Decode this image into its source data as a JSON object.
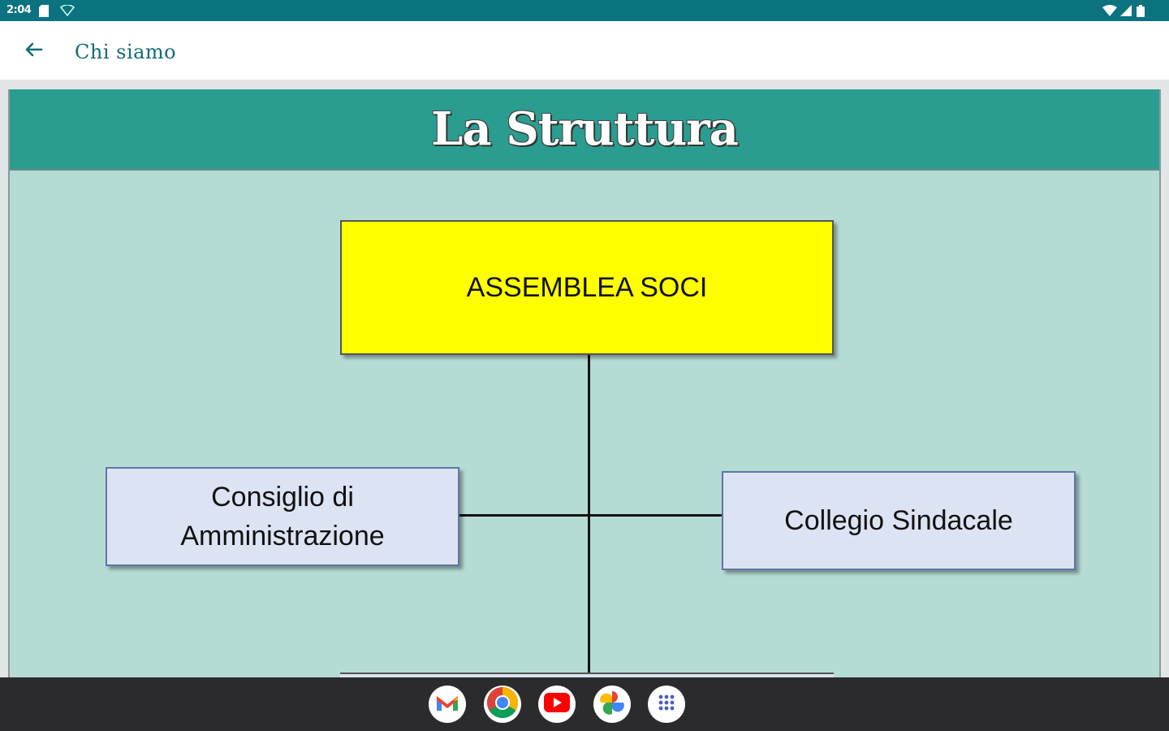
{
  "status_bar": {
    "time": "2:04",
    "left_icons": [
      "sd-card-icon",
      "wifi-notification-icon"
    ],
    "right_icons": [
      "wifi-icon",
      "cell-signal-icon",
      "battery-icon"
    ]
  },
  "app_bar": {
    "title": "Chi siamo",
    "back_icon": "arrow-left-icon"
  },
  "page": {
    "banner_title": "La Struttura",
    "org_chart": {
      "top": "ASSEMBLEA SOCI",
      "left_line1": "Consiglio di",
      "left_line2": "Amministrazione",
      "right": "Collegio Sindacale"
    }
  },
  "dock": {
    "apps": [
      "gmail-icon",
      "chrome-icon",
      "youtube-icon",
      "photos-icon",
      "app-drawer-icon"
    ]
  },
  "colors": {
    "status_bar": "#0b7280",
    "banner": "#2a9d90",
    "card_bg": "#b5dbd5",
    "top_box": "#ffff00",
    "sub_box": "#dce3f3"
  }
}
